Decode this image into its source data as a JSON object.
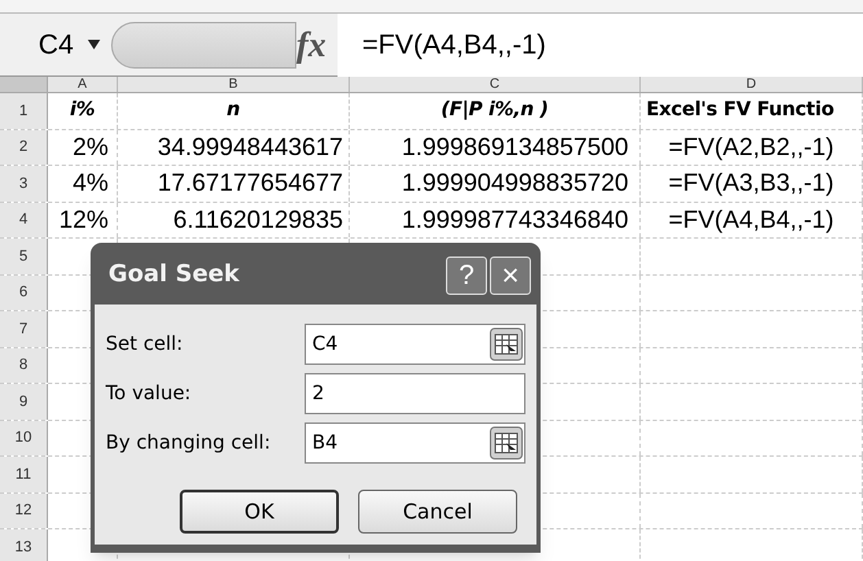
{
  "formula_bar": {
    "name_box": "C4",
    "fx_label": "fx",
    "formula": "=FV(A4,B4,,-1)"
  },
  "columns": [
    "A",
    "B",
    "C",
    "D"
  ],
  "rows": [
    {
      "number": "1",
      "kind": "heading",
      "cells": [
        {
          "text": "i%",
          "italic": true
        },
        {
          "text": "n",
          "italic": true
        },
        {
          "text": "(F|P i%,n )",
          "italic": true
        },
        {
          "text": "Excel's FV Functio",
          "italic": false
        }
      ]
    },
    {
      "number": "2",
      "kind": "data",
      "cells": [
        "2%",
        "34.99948443617",
        "1.999869134857500",
        "=FV(A2,B2,,-1)"
      ]
    },
    {
      "number": "3",
      "kind": "data",
      "cells": [
        "4%",
        "17.67177654677",
        "1.999904998835720",
        "=FV(A3,B3,,-1)"
      ]
    },
    {
      "number": "4",
      "kind": "data",
      "cells": [
        "12%",
        "6.11620129835",
        "1.999987743346840",
        "=FV(A4,B4,,-1)"
      ]
    },
    {
      "number": "5",
      "cells": []
    },
    {
      "number": "6",
      "cells": []
    },
    {
      "number": "7",
      "cells": []
    },
    {
      "number": "8",
      "cells": []
    },
    {
      "number": "9",
      "cells": []
    },
    {
      "number": "10",
      "cells": []
    },
    {
      "number": "11",
      "cells": []
    },
    {
      "number": "12",
      "cells": []
    },
    {
      "number": "13",
      "cells": []
    }
  ],
  "dialog": {
    "title": "Goal Seek",
    "help": "?",
    "close": "×",
    "fields": [
      {
        "label": "Set cell:",
        "value": "C4",
        "picker": true
      },
      {
        "label": "To value:",
        "value": "2",
        "picker": false
      },
      {
        "label": "By changing cell:",
        "value": "B4",
        "picker": true
      }
    ],
    "buttons": [
      {
        "label": "OK",
        "default": true
      },
      {
        "label": "Cancel",
        "default": false
      }
    ]
  }
}
